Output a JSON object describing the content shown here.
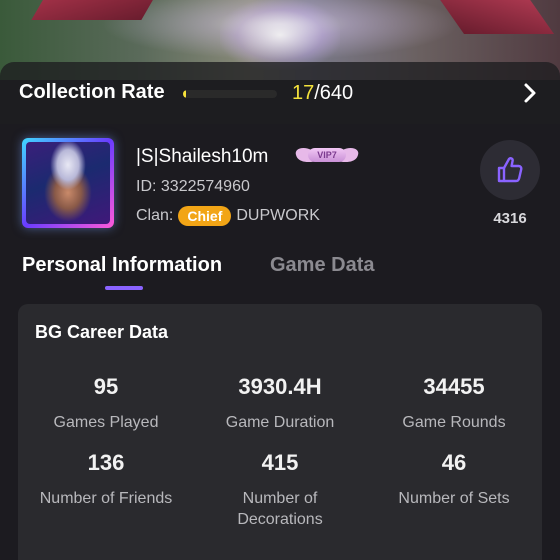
{
  "collection": {
    "title": "Collection Rate",
    "current": "17",
    "total": "/640",
    "progress_fraction": 0.027
  },
  "profile": {
    "username": "|S|Shailesh10m",
    "vip_label": "VIP7",
    "player_id": "ID: 3322574960",
    "clan_label": "Clan:",
    "clan_role": "Chief",
    "clan_name": "DUPWORK",
    "likes": "4316"
  },
  "tabs": [
    {
      "label": "Personal Information",
      "active": true
    },
    {
      "label": "Game Data",
      "active": false
    }
  ],
  "career": {
    "title": "BG Career Data",
    "stats": [
      {
        "value": "95",
        "label": "Games Played"
      },
      {
        "value": "3930.4H",
        "label": "Game Duration"
      },
      {
        "value": "34455",
        "label": "Game Rounds"
      },
      {
        "value": "136",
        "label": "Number of Friends"
      },
      {
        "value": "415",
        "label": "Number of Decorations"
      },
      {
        "value": "46",
        "label": "Number of Sets"
      }
    ]
  },
  "colors": {
    "accent": "#8a63ff",
    "progress": "#f7e23a",
    "chief_badge": "#f2a516",
    "background": "#1c1b20",
    "card": "#2a2a2e"
  }
}
